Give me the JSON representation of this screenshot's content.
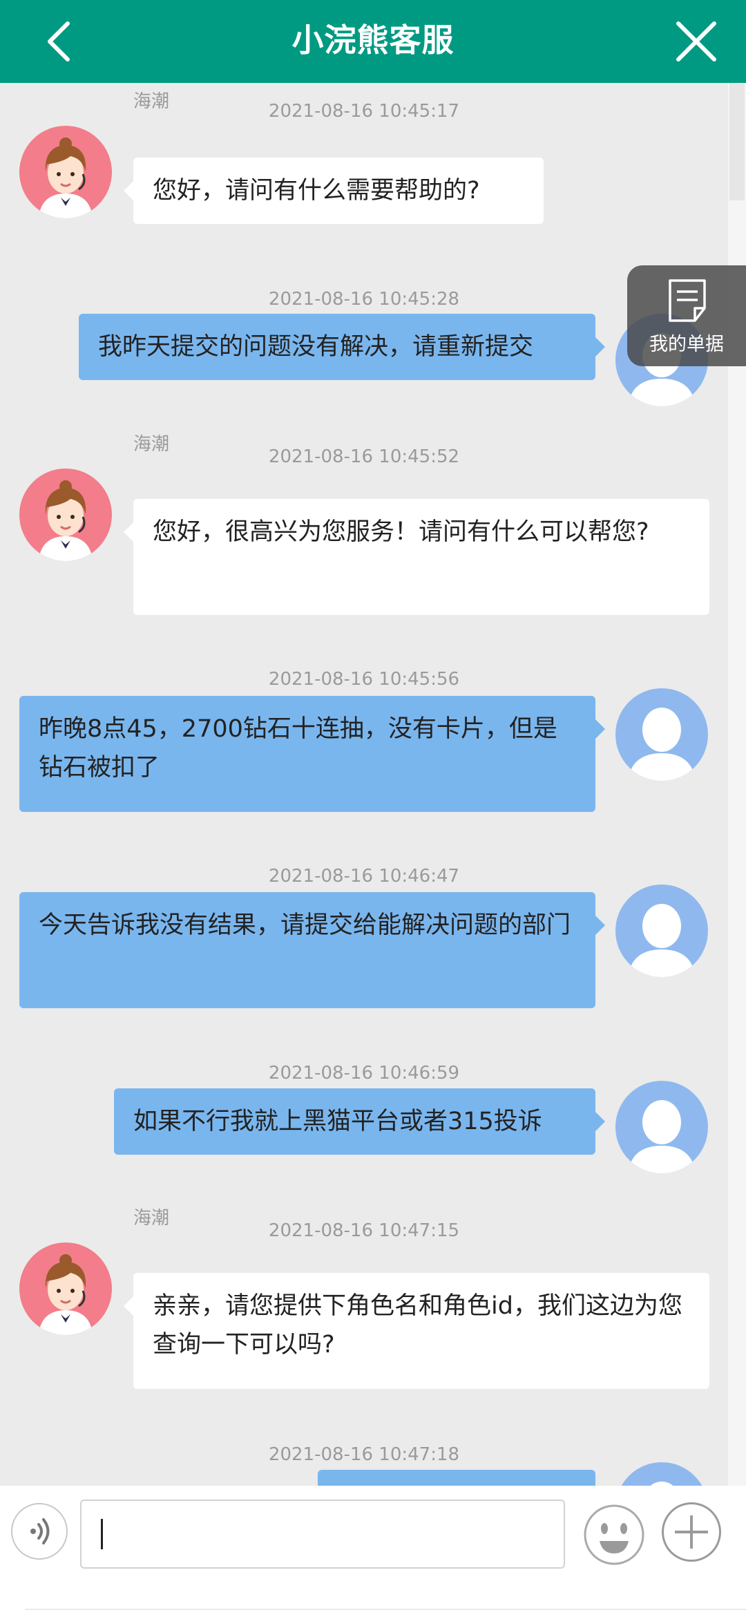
{
  "header": {
    "title": "小浣熊客服"
  },
  "floating": {
    "tickets_label": "我的单据"
  },
  "agent": {
    "name": "海潮"
  },
  "messages": [
    {
      "time": "2021-08-16 10:45:17",
      "from": "agent",
      "name": "海潮",
      "text": "您好，请问有什么需要帮助的?"
    },
    {
      "time": "2021-08-16 10:45:28",
      "from": "user",
      "text": "我昨天提交的问题没有解决，请重新提交"
    },
    {
      "time": "2021-08-16 10:45:52",
      "from": "agent",
      "name": "海潮",
      "text": "您好，很高兴为您服务！请问有什么可以帮您?"
    },
    {
      "time": "2021-08-16 10:45:56",
      "from": "user",
      "text": "昨晚8点45，2700钻石十连抽，没有卡片，但是钻石被扣了"
    },
    {
      "time": "2021-08-16 10:46:47",
      "from": "user",
      "text": "今天告诉我没有结果，请提交给能解决问题的部门"
    },
    {
      "time": "2021-08-16 10:46:59",
      "from": "user",
      "text": "如果不行我就上黑猫平台或者315投诉"
    },
    {
      "time": "2021-08-16 10:47:15",
      "from": "agent",
      "name": "海潮",
      "text": "亲亲，请您提供下角色名和角色id，我们这边为您查询一下可以吗?"
    },
    {
      "time": "2021-08-16 10:47:18",
      "from": "user",
      "text": ""
    }
  ],
  "input": {
    "value": "",
    "placeholder": ""
  },
  "icons": {
    "back": "chevron-left-icon",
    "close": "close-icon",
    "tickets": "document-icon",
    "voice": "voice-icon",
    "emoji": "emoji-icon",
    "plus": "plus-icon"
  },
  "colors": {
    "header": "#009a82",
    "user_bubble": "#7ab6ee",
    "agent_bubble": "#ffffff",
    "agent_avatar_bg": "#f37d8a",
    "user_avatar_bg": "#8fb9ee"
  }
}
